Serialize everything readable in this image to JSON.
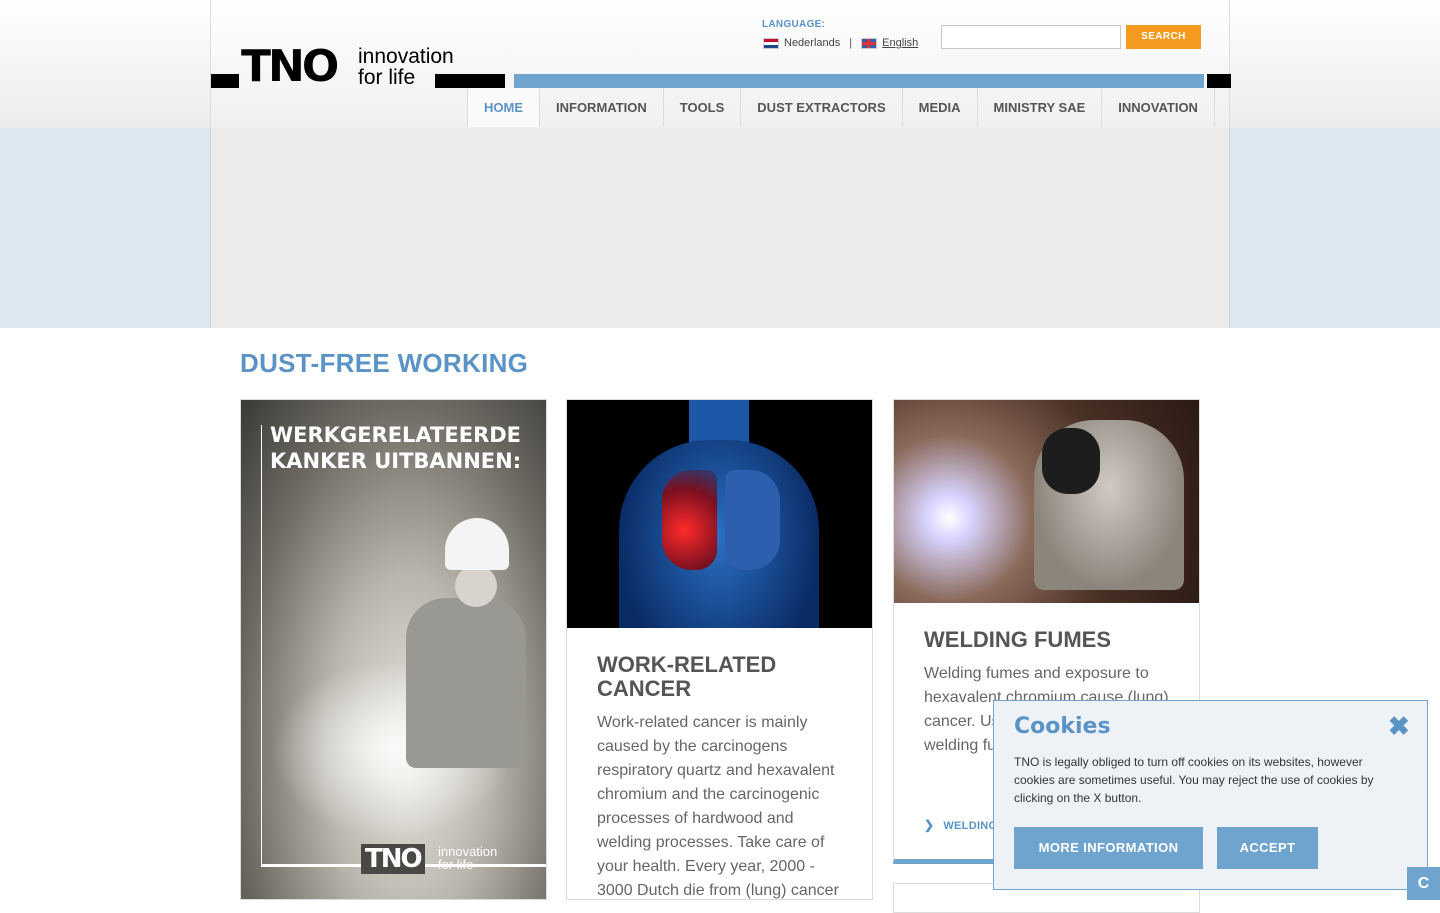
{
  "brand": {
    "logo_mark": "TNO",
    "logo_tagline": "innovation\nfor life"
  },
  "language": {
    "title": "LANGUAGE:",
    "options": [
      "Nederlands",
      "English"
    ],
    "separator": "|"
  },
  "search": {
    "placeholder": "",
    "button": "SEARCH"
  },
  "nav": {
    "items": [
      "HOME",
      "INFORMATION",
      "TOOLS",
      "DUST EXTRACTORS",
      "MEDIA",
      "MINISTRY SAE",
      "INNOVATION"
    ],
    "active": "HOME"
  },
  "page": {
    "title": "DUST-FREE WORKING"
  },
  "cards": [
    {
      "poster_title": "WERKGERELATEERDE KANKER UITBANNEN:",
      "poster_logo": "TNO",
      "poster_tagline": "innovation\nfor life"
    },
    {
      "title": "WORK-RELATED CANCER",
      "text": "Work-related cancer is mainly caused by the carcinogens respiratory quartz and hexavalent chromium and the carcinogenic processes of hardwood and welding processes. Take care of your health. Every year, 2000 - 3000 Dutch die from (lung) cancer"
    },
    {
      "title": "WELDING FUMES",
      "text": "Welding fumes and exposure to hexavalent chromium cause (lung) cancer. Us torches w reduces m welding fu",
      "link": "WELDING"
    }
  ],
  "cookie": {
    "title": "Cookies",
    "text": "TNO is legally obliged to turn off cookies on its websites, however cookies are sometimes useful. You may reject the use of cookies by clicking on the X button.",
    "more_button": "MORE INFORMATION",
    "accept_button": "ACCEPT",
    "close_icon": "close-icon"
  },
  "corner_tab": "C",
  "colors": {
    "accent": "#5a93c5",
    "ribbon": "#6fa4cf",
    "search_button": "#f39a1f"
  }
}
